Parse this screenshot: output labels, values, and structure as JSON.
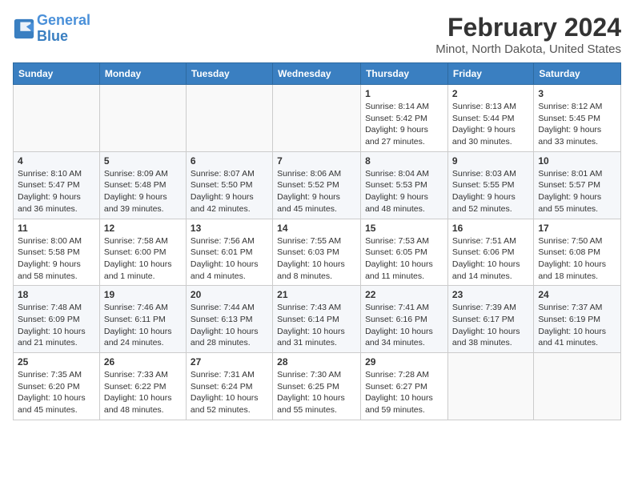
{
  "header": {
    "logo_line1": "General",
    "logo_line2": "Blue",
    "month": "February 2024",
    "location": "Minot, North Dakota, United States"
  },
  "days_of_week": [
    "Sunday",
    "Monday",
    "Tuesday",
    "Wednesday",
    "Thursday",
    "Friday",
    "Saturday"
  ],
  "weeks": [
    [
      {
        "day": "",
        "info": ""
      },
      {
        "day": "",
        "info": ""
      },
      {
        "day": "",
        "info": ""
      },
      {
        "day": "",
        "info": ""
      },
      {
        "day": "1",
        "info": "Sunrise: 8:14 AM\nSunset: 5:42 PM\nDaylight: 9 hours\nand 27 minutes."
      },
      {
        "day": "2",
        "info": "Sunrise: 8:13 AM\nSunset: 5:44 PM\nDaylight: 9 hours\nand 30 minutes."
      },
      {
        "day": "3",
        "info": "Sunrise: 8:12 AM\nSunset: 5:45 PM\nDaylight: 9 hours\nand 33 minutes."
      }
    ],
    [
      {
        "day": "4",
        "info": "Sunrise: 8:10 AM\nSunset: 5:47 PM\nDaylight: 9 hours\nand 36 minutes."
      },
      {
        "day": "5",
        "info": "Sunrise: 8:09 AM\nSunset: 5:48 PM\nDaylight: 9 hours\nand 39 minutes."
      },
      {
        "day": "6",
        "info": "Sunrise: 8:07 AM\nSunset: 5:50 PM\nDaylight: 9 hours\nand 42 minutes."
      },
      {
        "day": "7",
        "info": "Sunrise: 8:06 AM\nSunset: 5:52 PM\nDaylight: 9 hours\nand 45 minutes."
      },
      {
        "day": "8",
        "info": "Sunrise: 8:04 AM\nSunset: 5:53 PM\nDaylight: 9 hours\nand 48 minutes."
      },
      {
        "day": "9",
        "info": "Sunrise: 8:03 AM\nSunset: 5:55 PM\nDaylight: 9 hours\nand 52 minutes."
      },
      {
        "day": "10",
        "info": "Sunrise: 8:01 AM\nSunset: 5:57 PM\nDaylight: 9 hours\nand 55 minutes."
      }
    ],
    [
      {
        "day": "11",
        "info": "Sunrise: 8:00 AM\nSunset: 5:58 PM\nDaylight: 9 hours\nand 58 minutes."
      },
      {
        "day": "12",
        "info": "Sunrise: 7:58 AM\nSunset: 6:00 PM\nDaylight: 10 hours\nand 1 minute."
      },
      {
        "day": "13",
        "info": "Sunrise: 7:56 AM\nSunset: 6:01 PM\nDaylight: 10 hours\nand 4 minutes."
      },
      {
        "day": "14",
        "info": "Sunrise: 7:55 AM\nSunset: 6:03 PM\nDaylight: 10 hours\nand 8 minutes."
      },
      {
        "day": "15",
        "info": "Sunrise: 7:53 AM\nSunset: 6:05 PM\nDaylight: 10 hours\nand 11 minutes."
      },
      {
        "day": "16",
        "info": "Sunrise: 7:51 AM\nSunset: 6:06 PM\nDaylight: 10 hours\nand 14 minutes."
      },
      {
        "day": "17",
        "info": "Sunrise: 7:50 AM\nSunset: 6:08 PM\nDaylight: 10 hours\nand 18 minutes."
      }
    ],
    [
      {
        "day": "18",
        "info": "Sunrise: 7:48 AM\nSunset: 6:09 PM\nDaylight: 10 hours\nand 21 minutes."
      },
      {
        "day": "19",
        "info": "Sunrise: 7:46 AM\nSunset: 6:11 PM\nDaylight: 10 hours\nand 24 minutes."
      },
      {
        "day": "20",
        "info": "Sunrise: 7:44 AM\nSunset: 6:13 PM\nDaylight: 10 hours\nand 28 minutes."
      },
      {
        "day": "21",
        "info": "Sunrise: 7:43 AM\nSunset: 6:14 PM\nDaylight: 10 hours\nand 31 minutes."
      },
      {
        "day": "22",
        "info": "Sunrise: 7:41 AM\nSunset: 6:16 PM\nDaylight: 10 hours\nand 34 minutes."
      },
      {
        "day": "23",
        "info": "Sunrise: 7:39 AM\nSunset: 6:17 PM\nDaylight: 10 hours\nand 38 minutes."
      },
      {
        "day": "24",
        "info": "Sunrise: 7:37 AM\nSunset: 6:19 PM\nDaylight: 10 hours\nand 41 minutes."
      }
    ],
    [
      {
        "day": "25",
        "info": "Sunrise: 7:35 AM\nSunset: 6:20 PM\nDaylight: 10 hours\nand 45 minutes."
      },
      {
        "day": "26",
        "info": "Sunrise: 7:33 AM\nSunset: 6:22 PM\nDaylight: 10 hours\nand 48 minutes."
      },
      {
        "day": "27",
        "info": "Sunrise: 7:31 AM\nSunset: 6:24 PM\nDaylight: 10 hours\nand 52 minutes."
      },
      {
        "day": "28",
        "info": "Sunrise: 7:30 AM\nSunset: 6:25 PM\nDaylight: 10 hours\nand 55 minutes."
      },
      {
        "day": "29",
        "info": "Sunrise: 7:28 AM\nSunset: 6:27 PM\nDaylight: 10 hours\nand 59 minutes."
      },
      {
        "day": "",
        "info": ""
      },
      {
        "day": "",
        "info": ""
      }
    ]
  ]
}
